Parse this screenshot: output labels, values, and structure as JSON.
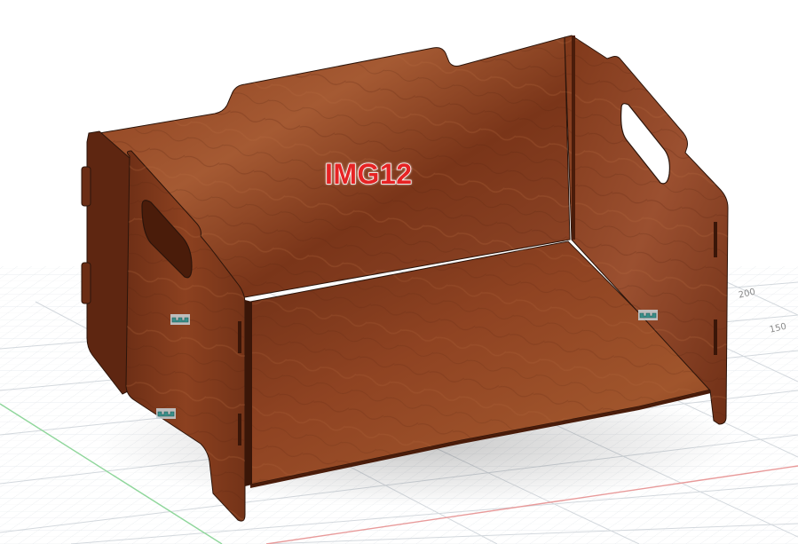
{
  "viewport": {
    "label": "IMG12",
    "label_color": "#e62324",
    "background": "#ffffff",
    "grid_color": "#d8dde2",
    "axis_red": "#e89a9a",
    "axis_green": "#8fd69b"
  },
  "grid": {
    "tick_labels": [
      "200",
      "150"
    ]
  },
  "model": {
    "material": "walnut-wood",
    "wood_base": "#7a3519",
    "wood_mid": "#8f4322",
    "wood_light": "#a55a33",
    "wood_dark": "#5a2410",
    "edge_color": "#2b140a"
  },
  "markers": [
    {
      "name": "joint-icon"
    },
    {
      "name": "joint-icon"
    },
    {
      "name": "joint-icon"
    }
  ]
}
